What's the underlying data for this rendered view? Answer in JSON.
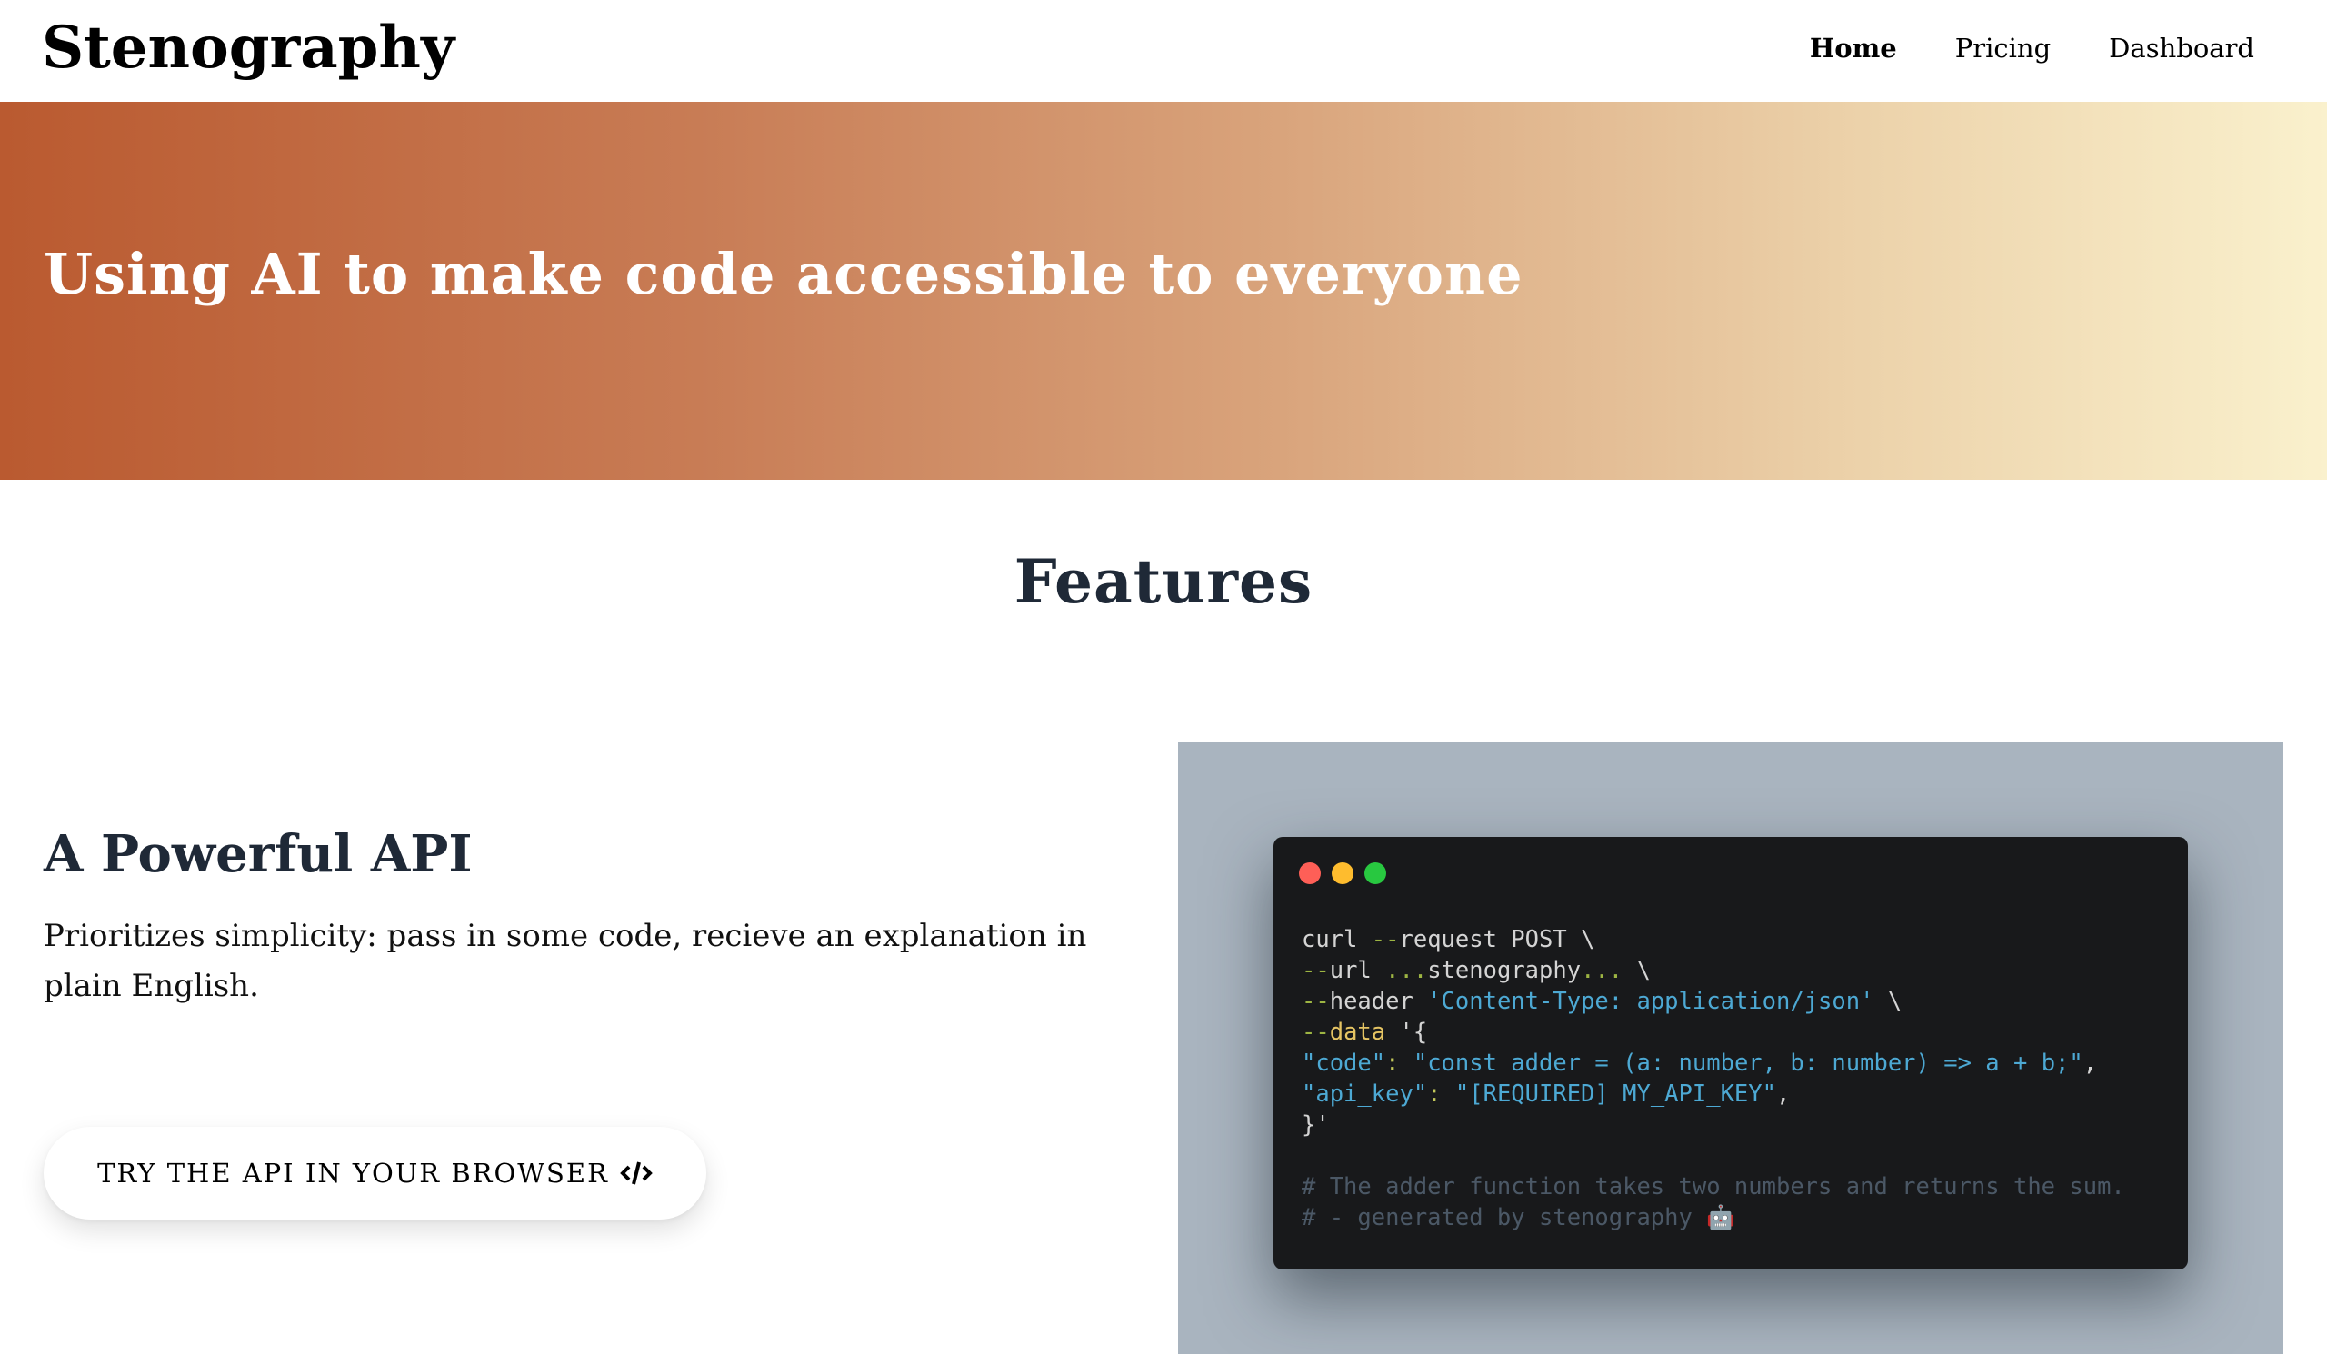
{
  "header": {
    "logo": "Stenography",
    "nav": [
      {
        "label": "Home",
        "active": true
      },
      {
        "label": "Pricing",
        "active": false
      },
      {
        "label": "Dashboard",
        "active": false
      }
    ]
  },
  "hero": {
    "title": "Using AI to make code accessible to everyone",
    "gradient_start": "#ba5a30",
    "gradient_end": "#faf1cd"
  },
  "features": {
    "title": "Features",
    "items": [
      {
        "heading": "A Powerful API",
        "description": "Prioritizes simplicity: pass in some code, recieve an explanation in plain English.",
        "cta_label": "Try the API in your browser",
        "cta_icon": "code-icon"
      }
    ]
  },
  "code_window": {
    "dots": [
      {
        "name": "close",
        "color": "#fe5f57"
      },
      {
        "name": "minimize",
        "color": "#febc2e"
      },
      {
        "name": "maximize",
        "color": "#28c840"
      }
    ],
    "lines": [
      [
        {
          "t": "curl ",
          "c": "plain"
        },
        {
          "t": "--",
          "c": "flag"
        },
        {
          "t": "request POST \\",
          "c": "plain"
        }
      ],
      [
        {
          "t": "--",
          "c": "flag"
        },
        {
          "t": "url ",
          "c": "plain"
        },
        {
          "t": "...",
          "c": "flag"
        },
        {
          "t": "stenography",
          "c": "plain"
        },
        {
          "t": "...",
          "c": "flag"
        },
        {
          "t": " \\",
          "c": "plain"
        }
      ],
      [
        {
          "t": "--",
          "c": "flag"
        },
        {
          "t": "header ",
          "c": "plain"
        },
        {
          "t": "'Content-Type: application/json'",
          "c": "string"
        },
        {
          "t": " \\",
          "c": "plain"
        }
      ],
      [
        {
          "t": "--",
          "c": "flag"
        },
        {
          "t": "data",
          "c": "keyword"
        },
        {
          "t": " '{",
          "c": "plain"
        }
      ],
      [
        {
          "t": "\"code\"",
          "c": "string"
        },
        {
          "t": ": ",
          "c": "punct"
        },
        {
          "t": "\"const adder = (a: number, b: number) => a + b;\"",
          "c": "string"
        },
        {
          "t": ",",
          "c": "plain"
        }
      ],
      [
        {
          "t": "\"api_key\"",
          "c": "string"
        },
        {
          "t": ": ",
          "c": "punct"
        },
        {
          "t": "\"[REQUIRED] MY_API_KEY\"",
          "c": "string"
        },
        {
          "t": ",",
          "c": "plain"
        }
      ],
      [
        {
          "t": "}'",
          "c": "plain"
        }
      ],
      [
        {
          "t": "",
          "c": "plain"
        }
      ],
      [
        {
          "t": "# The adder function takes two numbers and returns the sum.",
          "c": "comment"
        }
      ],
      [
        {
          "t": "# - generated by stenography 🤖",
          "c": "comment"
        }
      ]
    ]
  }
}
